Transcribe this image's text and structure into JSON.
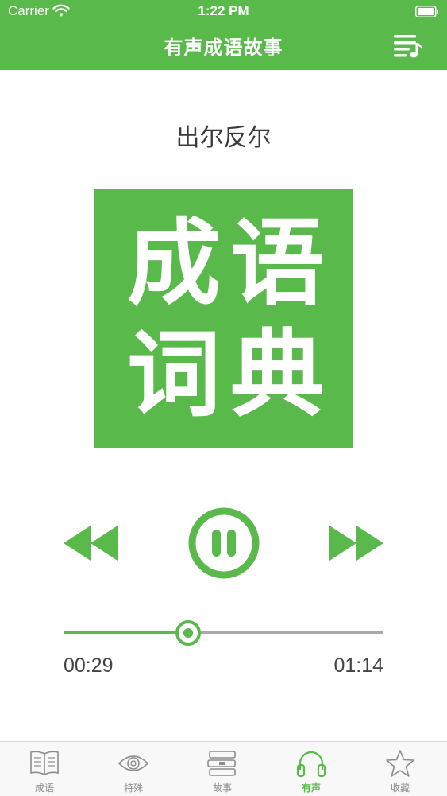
{
  "status_bar": {
    "carrier": "Carrier",
    "time": "1:22 PM"
  },
  "nav": {
    "title": "有声成语故事",
    "playlist_icon": "playlist-music-icon"
  },
  "track": {
    "title": "出尔反尔"
  },
  "cover": {
    "chars": [
      "成",
      "语",
      "词",
      "典"
    ]
  },
  "player": {
    "state": "playing",
    "current_time": "00:29",
    "total_time": "01:14",
    "progress": 0.39
  },
  "tabs": [
    {
      "label": "成语",
      "icon": "book-icon",
      "active": false
    },
    {
      "label": "特殊",
      "icon": "eye-icon",
      "active": false
    },
    {
      "label": "故事",
      "icon": "books-stack-icon",
      "active": false
    },
    {
      "label": "有声",
      "icon": "headphones-icon",
      "active": true
    },
    {
      "label": "收藏",
      "icon": "star-icon",
      "active": false
    }
  ],
  "colors": {
    "accent": "#59b94b",
    "inactive": "#8c8c8c"
  }
}
